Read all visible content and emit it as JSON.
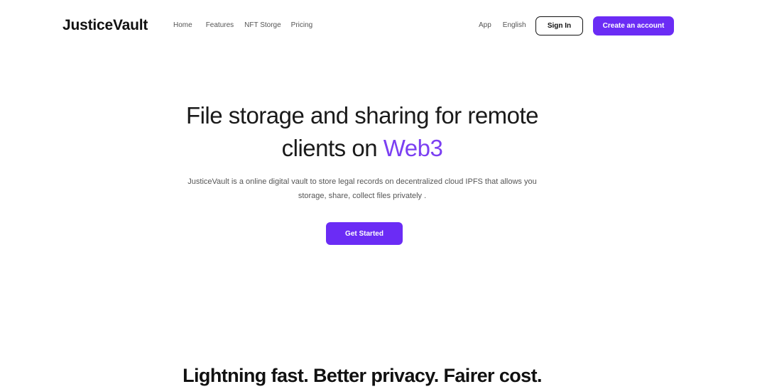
{
  "header": {
    "logo": "JusticeVault",
    "nav": [
      "Home",
      "Features",
      "NFT Storge",
      "Pricing"
    ],
    "app_link": "App",
    "language": "English",
    "signin_label": "Sign In",
    "create_label": "Create an account"
  },
  "hero": {
    "title_line1": "File storage and sharing for remote",
    "title_line2_prefix": "clients on ",
    "title_accent": "Web3",
    "subtitle_line1": "JusticeVault is a online digital vault to store legal records on decentralized cloud IPFS that allows you",
    "subtitle_line2": "storage, share, collect files privately .",
    "cta_label": "Get Started"
  },
  "section": {
    "title": "Lightning fast. Better privacy. Fairer cost."
  },
  "colors": {
    "accent": "#6b2cf5",
    "accent_text": "#7b3ff2"
  }
}
